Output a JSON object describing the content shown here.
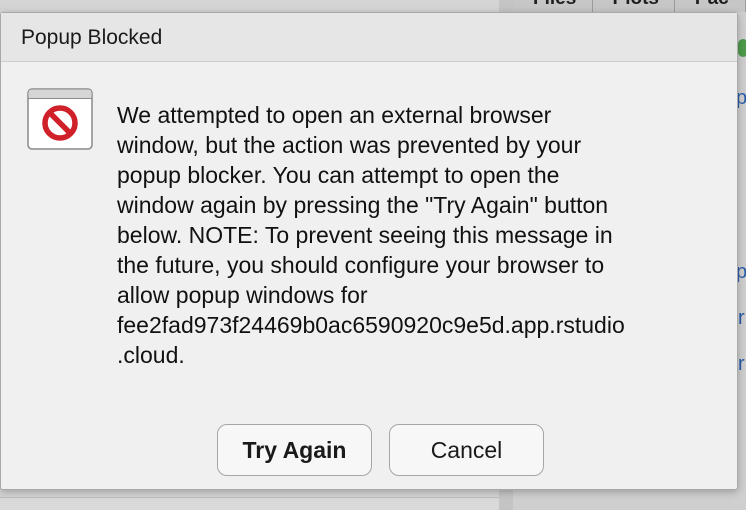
{
  "background": {
    "tabs": [
      "Files",
      "Plots",
      "Pac"
    ],
    "link_fragments": [
      "p",
      "p",
      "r",
      "r"
    ]
  },
  "dialog": {
    "title": "Popup Blocked",
    "icon": "blocked-circle-icon",
    "message": "We attempted to open an external browser\nwindow, but the action was prevented by your\npopup blocker. You can attempt to open the\nwindow again by pressing the \"Try Again\" button\nbelow. NOTE: To prevent seeing this message in\nthe future, you should configure your browser to\nallow popup windows for\nfee2fad973f24469b0ac6590920c9e5d.app.rstudio\n.cloud.",
    "buttons": {
      "try_again": "Try Again",
      "cancel": "Cancel"
    }
  },
  "colors": {
    "dialog_bg": "#f0f0f0",
    "header_bg": "#e6e6e6",
    "icon_red": "#d0202a",
    "link_blue": "#2a5caa"
  }
}
